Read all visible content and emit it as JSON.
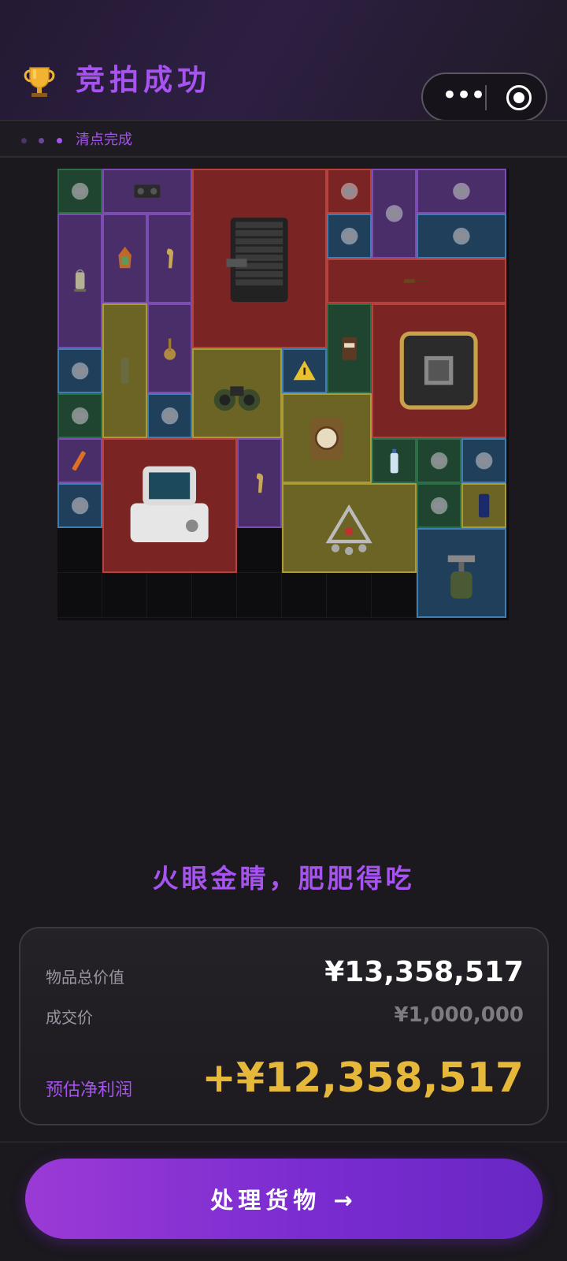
{
  "header": {
    "title": "竞拍成功",
    "trophy_icon": "trophy-icon",
    "menu_icon": "more-dots-icon",
    "close_icon": "target-close-icon"
  },
  "status": {
    "text": "清点完成"
  },
  "inventory": {
    "items": [
      {
        "name": "hard-drive",
        "rarity": "green"
      },
      {
        "name": "boombox",
        "rarity": "purple"
      },
      {
        "name": "server-rack",
        "rarity": "red"
      },
      {
        "name": "sensor-module",
        "rarity": "red"
      },
      {
        "name": "battery-pack",
        "rarity": "purple"
      },
      {
        "name": "sound-card",
        "rarity": "purple"
      },
      {
        "name": "lantern",
        "rarity": "purple"
      },
      {
        "name": "ornate-lantern",
        "rarity": "purple"
      },
      {
        "name": "golden-statuette",
        "rarity": "purple"
      },
      {
        "name": "optical-disc",
        "rarity": "blue"
      },
      {
        "name": "power-drill",
        "rarity": "blue"
      },
      {
        "name": "musket",
        "rarity": "red"
      },
      {
        "name": "blueprint-tube",
        "rarity": "yellow"
      },
      {
        "name": "hookah",
        "rarity": "purple"
      },
      {
        "name": "coffee-bag",
        "rarity": "green"
      },
      {
        "name": "gpu-chip",
        "rarity": "red"
      },
      {
        "name": "security-camera",
        "rarity": "blue"
      },
      {
        "name": "binoculars",
        "rarity": "yellow"
      },
      {
        "name": "warning-sign",
        "rarity": "blue"
      },
      {
        "name": "power-strip",
        "rarity": "green"
      },
      {
        "name": "capacitor-box",
        "rarity": "blue"
      },
      {
        "name": "mantel-clock",
        "rarity": "yellow"
      },
      {
        "name": "flare",
        "rarity": "purple"
      },
      {
        "name": "medical-monitor",
        "rarity": "red"
      },
      {
        "name": "golden-statuette",
        "rarity": "purple"
      },
      {
        "name": "water-bottle",
        "rarity": "green"
      },
      {
        "name": "screwdriver",
        "rarity": "green"
      },
      {
        "name": "caliper",
        "rarity": "blue"
      },
      {
        "name": "ammo-tin",
        "rarity": "blue"
      },
      {
        "name": "pendant",
        "rarity": "yellow"
      },
      {
        "name": "ssd-drive",
        "rarity": "green"
      },
      {
        "name": "smartphone",
        "rarity": "yellow"
      },
      {
        "name": "camp-stove",
        "rarity": "blue"
      }
    ]
  },
  "slogan": "火眼金睛，肥肥得吃",
  "summary": {
    "total_label": "物品总价值",
    "total_value": "¥13,358,517",
    "price_label": "成交价",
    "price_value": "¥1,000,000",
    "profit_label": "预估净利润",
    "profit_value": "+¥12,358,517"
  },
  "cta": {
    "label": "处理货物 →"
  },
  "colors": {
    "accent": "#a653f0",
    "profit": "#e6b83a",
    "rarity_green": "#1f4430",
    "rarity_purple": "#4a2e6a",
    "rarity_red": "#7a2424",
    "rarity_blue": "#203f5b",
    "rarity_yellow": "#6c6424"
  }
}
